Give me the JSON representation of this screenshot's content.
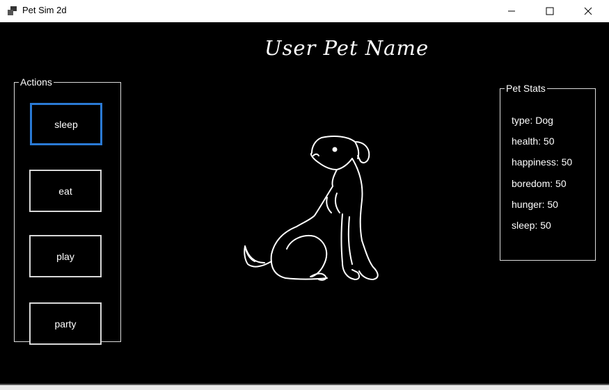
{
  "window": {
    "title": "Pet Sim 2d",
    "app_icon": "app-window-icon",
    "controls": [
      "minimize-icon",
      "maximize-icon",
      "close-icon"
    ]
  },
  "pet": {
    "name": "User Pet Name",
    "image_icon": "dog-outline-icon"
  },
  "actions": {
    "legend": "Actions",
    "buttons": [
      "sleep",
      "eat",
      "play",
      "party"
    ]
  },
  "stats": {
    "legend": "Pet Stats",
    "lines": [
      "type: Dog",
      "health: 50",
      "happiness: 50",
      "boredom: 50",
      "hunger: 50",
      "sleep: 50"
    ]
  },
  "colors": {
    "background": "#000000",
    "titlebar": "#ffffff",
    "focus_border": "#2a7ad5"
  }
}
